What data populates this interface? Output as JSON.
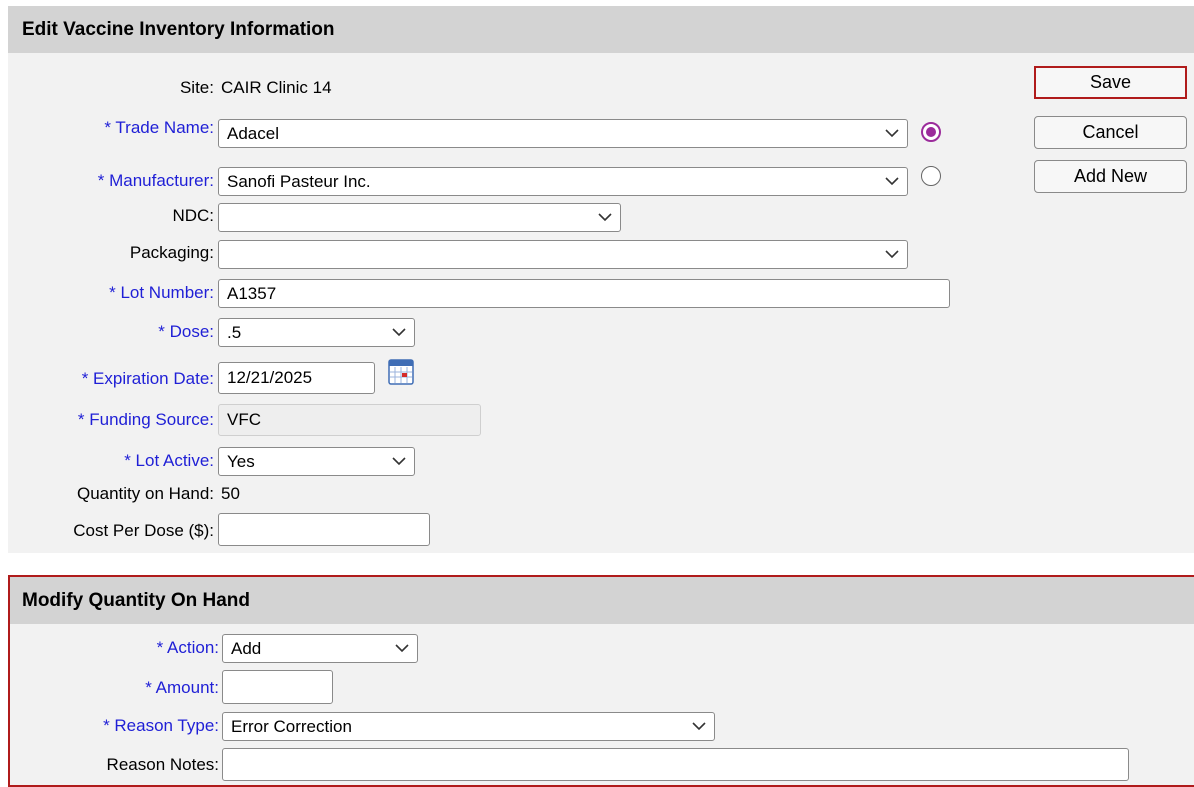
{
  "edit_section": {
    "title": "Edit Vaccine Inventory Information",
    "site_label": "Site:",
    "site_value": "CAIR Clinic 14",
    "trade_name_label": "* Trade Name:",
    "trade_name_value": "Adacel",
    "trade_name_radio_selected": true,
    "manufacturer_label": "* Manufacturer:",
    "manufacturer_value": "Sanofi Pasteur Inc.",
    "manufacturer_radio_selected": false,
    "ndc_label": "NDC:",
    "ndc_value": "",
    "packaging_label": "Packaging:",
    "packaging_value": "",
    "lot_number_label": "* Lot Number:",
    "lot_number_value": "A1357",
    "dose_label": "* Dose:",
    "dose_value": ".5",
    "expiration_label": "* Expiration Date:",
    "expiration_value": "12/21/2025",
    "funding_label": "* Funding Source:",
    "funding_value": "VFC",
    "lot_active_label": "* Lot Active:",
    "lot_active_value": "Yes",
    "qoh_label": "Quantity on Hand:",
    "qoh_value": "50",
    "cost_label": "Cost Per Dose ($):",
    "cost_value": ""
  },
  "buttons": {
    "save": "Save",
    "cancel": "Cancel",
    "add_new": "Add New"
  },
  "modify_section": {
    "title": "Modify Quantity On Hand",
    "action_label": "* Action:",
    "action_value": "Add",
    "amount_label": "* Amount:",
    "amount_value": "",
    "reason_type_label": "* Reason Type:",
    "reason_type_value": "Error Correction",
    "reason_notes_label": "Reason Notes:",
    "reason_notes_value": ""
  },
  "colors": {
    "required_label": "#1f1fd6",
    "highlight_border": "#b01b1b",
    "header_bg": "#d3d3d3",
    "panel_bg": "#f2f2f2",
    "radio_selected": "#9b2b9b"
  },
  "icons": [
    "chevron-down-icon",
    "calendar-icon"
  ]
}
